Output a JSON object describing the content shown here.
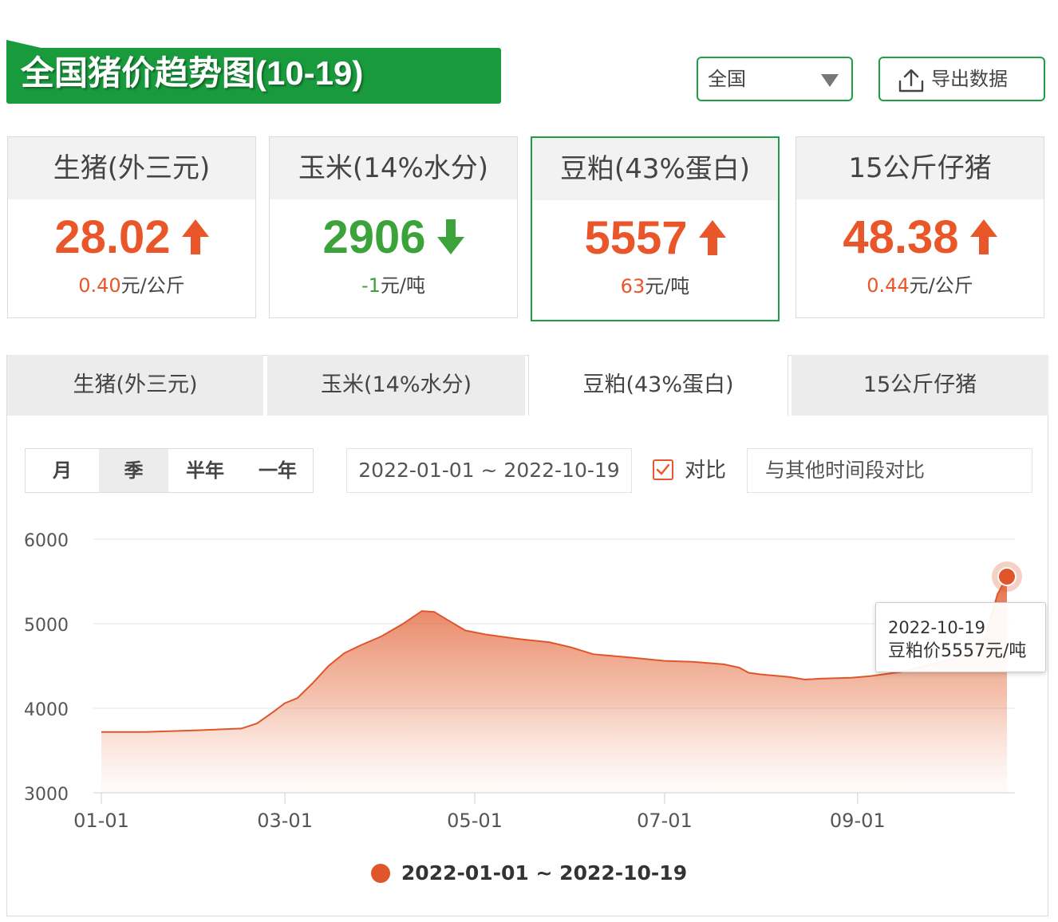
{
  "header": {
    "title": "全国猪价趋势图(10-19)",
    "brand_color": "#199a3c"
  },
  "controls": {
    "region": {
      "value": "全国"
    },
    "export_label": "导出数据",
    "export_icon": "upload-icon"
  },
  "cards": [
    {
      "name": "生猪(外三元)",
      "price": "28.02",
      "direction": "up",
      "change": "0.40",
      "unit": "元/公斤"
    },
    {
      "name": "玉米(14%水分)",
      "price": "2906",
      "direction": "down",
      "change": "-1",
      "unit": "元/吨"
    },
    {
      "name": "豆粕(43%蛋白)",
      "price": "5557",
      "direction": "up",
      "change": "63",
      "unit": "元/吨"
    },
    {
      "name": "15公斤仔猪",
      "price": "48.38",
      "direction": "up",
      "change": "0.44",
      "unit": "元/公斤"
    }
  ],
  "colors": {
    "up": "#e8562a",
    "down": "#3ca33b",
    "series": "#e0562a"
  },
  "tabs": [
    "生猪(外三元)",
    "玉米(14%水分)",
    "豆粕(43%蛋白)",
    "15公斤仔猪"
  ],
  "active_tab": 2,
  "range_buttons": [
    "月",
    "季",
    "半年",
    "一年"
  ],
  "selected_range": 1,
  "date_range": "2022-01-01 ~ 2022-10-19",
  "compare": {
    "checked": true,
    "label": "对比",
    "placeholder": "与其他时间段对比"
  },
  "tooltip": {
    "date": "2022-10-19",
    "text": "豆粕价5557元/吨"
  },
  "chart_data": {
    "type": "area",
    "series": [
      {
        "name": "2022-01-01 ~ 2022-10-19",
        "points": [
          [
            "2022-01-01",
            3720
          ],
          [
            "2022-01-15",
            3720
          ],
          [
            "2022-02-01",
            3740
          ],
          [
            "2022-02-15",
            3760
          ],
          [
            "2022-02-20",
            3820
          ],
          [
            "2022-02-25",
            3950
          ],
          [
            "2022-03-01",
            4060
          ],
          [
            "2022-03-05",
            4120
          ],
          [
            "2022-03-10",
            4300
          ],
          [
            "2022-03-15",
            4500
          ],
          [
            "2022-03-20",
            4650
          ],
          [
            "2022-03-25",
            4740
          ],
          [
            "2022-04-01",
            4850
          ],
          [
            "2022-04-08",
            5000
          ],
          [
            "2022-04-14",
            5150
          ],
          [
            "2022-04-18",
            5140
          ],
          [
            "2022-04-22",
            5050
          ],
          [
            "2022-04-28",
            4920
          ],
          [
            "2022-05-05",
            4870
          ],
          [
            "2022-05-15",
            4820
          ],
          [
            "2022-05-25",
            4780
          ],
          [
            "2022-06-01",
            4720
          ],
          [
            "2022-06-08",
            4640
          ],
          [
            "2022-06-20",
            4600
          ],
          [
            "2022-07-01",
            4560
          ],
          [
            "2022-07-10",
            4550
          ],
          [
            "2022-07-20",
            4520
          ],
          [
            "2022-07-25",
            4480
          ],
          [
            "2022-07-28",
            4420
          ],
          [
            "2022-08-01",
            4400
          ],
          [
            "2022-08-10",
            4370
          ],
          [
            "2022-08-15",
            4340
          ],
          [
            "2022-08-20",
            4350
          ],
          [
            "2022-08-30",
            4360
          ],
          [
            "2022-09-05",
            4380
          ],
          [
            "2022-09-15",
            4430
          ],
          [
            "2022-09-25",
            4520
          ],
          [
            "2022-10-05",
            4620
          ],
          [
            "2022-10-12",
            4850
          ],
          [
            "2022-10-16",
            5350
          ],
          [
            "2022-10-19",
            5557
          ]
        ]
      }
    ],
    "x_ticks": [
      "01-01",
      "03-01",
      "05-01",
      "07-01",
      "09-01"
    ],
    "y_ticks": [
      3000,
      4000,
      5000,
      6000
    ],
    "ylim": [
      3000,
      6000
    ],
    "xlim": [
      "2022-01-01",
      "2022-10-19"
    ],
    "grid": true,
    "legend": "bottom-center",
    "highlight": [
      "2022-10-19",
      5557
    ]
  }
}
